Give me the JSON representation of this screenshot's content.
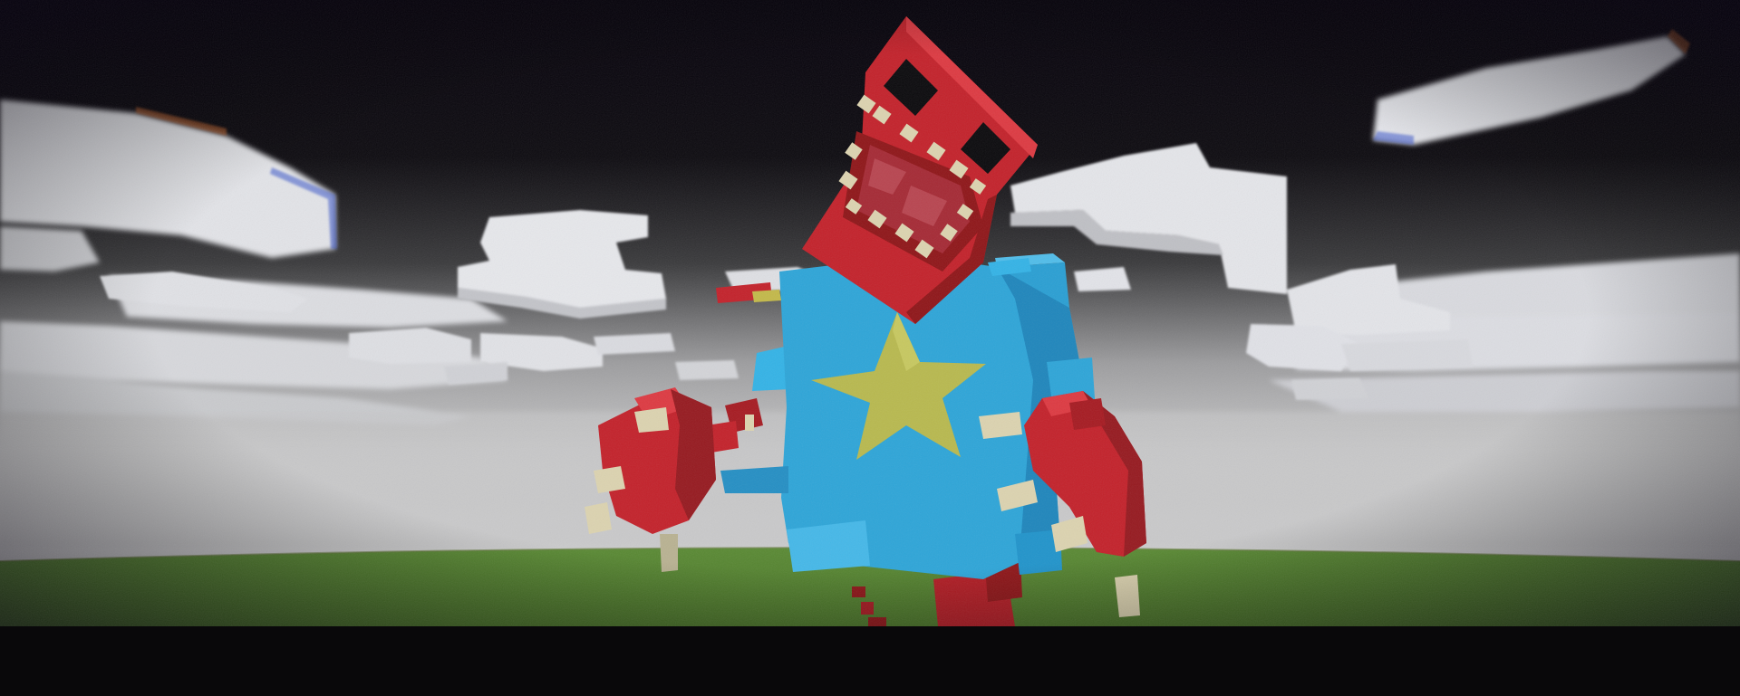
{
  "scene": {
    "subject": "blocky-red-box-head-creature",
    "environment": "voxel-sky-with-clouds-and-grass",
    "colors": {
      "sky_top": "#07030f",
      "sky_bottom": "#cfcfd0",
      "grass": "#55832f",
      "cloud": "#e3e4e8",
      "cloud_shadow": "#c5c6cc",
      "body_blue": "#2ea5d8",
      "body_blue_shade": "#1f86bc",
      "star_yellow": "#b7b84f",
      "head_red": "#c3222b",
      "head_red_dark": "#8f1619",
      "tooth": "#dcd3b0",
      "letterbox": "#09080a"
    }
  }
}
